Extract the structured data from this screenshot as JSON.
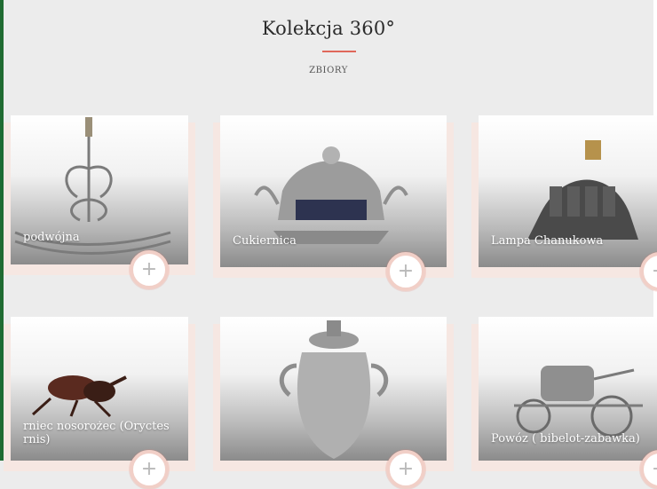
{
  "header": {
    "title": "Kolekcja 360°",
    "subtitle": "ZBIORY"
  },
  "cards": [
    {
      "label": "podwójna",
      "plus": "+"
    },
    {
      "label": "Cukiernica",
      "plus": "+"
    },
    {
      "label": "Lampa Chanukowa",
      "plus": "+"
    },
    {
      "label": "rniec nosorożec (Oryctes rnis)",
      "plus": "+"
    },
    {
      "label": "",
      "plus": "+"
    },
    {
      "label": "Powóz ( bibelot-zabawka)",
      "plus": "+"
    }
  ],
  "colors": {
    "background": "#ececec",
    "accent": "#e0675a",
    "ring": "#f1cfc7"
  },
  "icons": [
    "plus-icon"
  ]
}
